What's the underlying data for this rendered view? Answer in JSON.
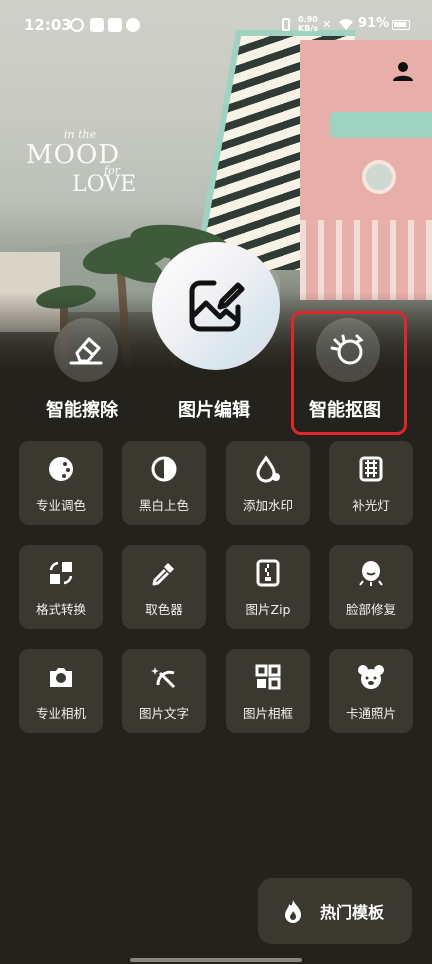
{
  "status_bar": {
    "time": "12:03",
    "net_speed_value": "0.90",
    "net_speed_unit": "KB/s",
    "battery": "91%"
  },
  "banner": {
    "line1": "in the",
    "line2": "MOOD",
    "line3": "for",
    "line4": "LOVE"
  },
  "primary_actions": {
    "erase": "智能擦除",
    "edit": "图片编辑",
    "cutout": "智能抠图"
  },
  "tools": [
    {
      "label": "专业调色",
      "icon": "color-grading-icon"
    },
    {
      "label": "黑白上色",
      "icon": "black-white-icon"
    },
    {
      "label": "添加水印",
      "icon": "watermark-icon"
    },
    {
      "label": "补光灯",
      "icon": "fill-light-icon"
    },
    {
      "label": "格式转换",
      "icon": "format-convert-icon"
    },
    {
      "label": "取色器",
      "icon": "color-picker-icon"
    },
    {
      "label": "图片Zip",
      "icon": "zip-icon"
    },
    {
      "label": "脸部修复",
      "icon": "face-repair-icon"
    },
    {
      "label": "专业相机",
      "icon": "camera-icon"
    },
    {
      "label": "图片文字",
      "icon": "text-magic-icon"
    },
    {
      "label": "图片相框",
      "icon": "frame-icon"
    },
    {
      "label": "卡通照片",
      "icon": "cartoon-icon"
    }
  ],
  "hot_templates": "热门模板",
  "colors": {
    "background": "#24221c",
    "tile": "#3a382f",
    "highlight": "#e0262b"
  }
}
